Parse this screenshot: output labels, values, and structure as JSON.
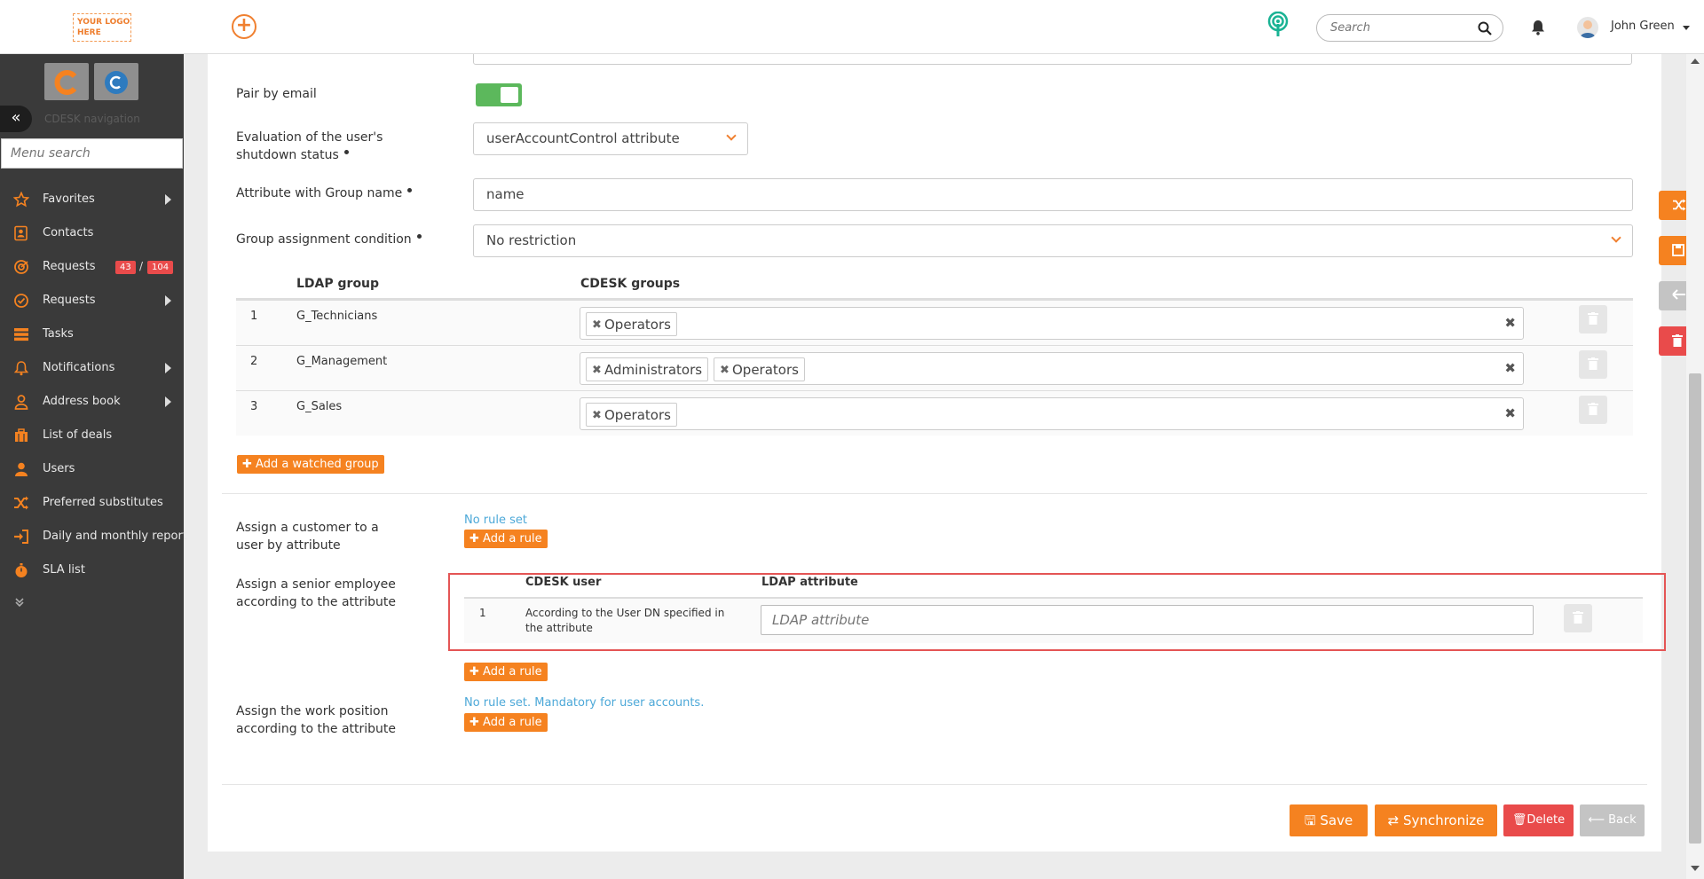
{
  "header": {
    "logo_line1": "YOUR LOGO",
    "logo_line2": "HERE",
    "search_placeholder": "Search",
    "user_name": "John Green"
  },
  "sidebar": {
    "nav_title": "CDESK navigation",
    "menu_search_placeholder": "Menu search",
    "items": [
      {
        "label": "Favorites",
        "icon": "star-icon",
        "submenu": true
      },
      {
        "label": "Contacts",
        "icon": "contact-card-icon",
        "submenu": false
      },
      {
        "label": "Requests",
        "icon": "requests-icon",
        "submenu": false,
        "badge1": "43",
        "badge_sep": "/",
        "badge2": "104"
      },
      {
        "label": "Requests",
        "icon": "check-circle-icon",
        "submenu": true
      },
      {
        "label": "Tasks",
        "icon": "tasks-icon",
        "submenu": false
      },
      {
        "label": "Notifications",
        "icon": "bell-icon",
        "submenu": true
      },
      {
        "label": "Address book",
        "icon": "person-outline-icon",
        "submenu": true
      },
      {
        "label": "List of deals",
        "icon": "deals-icon",
        "submenu": false
      },
      {
        "label": "Users",
        "icon": "user-icon",
        "submenu": false
      },
      {
        "label": "Preferred substitutes",
        "icon": "shuffle-icon",
        "submenu": false
      },
      {
        "label": "Daily and monthly report",
        "icon": "sign-in-icon",
        "submenu": false
      },
      {
        "label": "SLA list",
        "icon": "stopwatch-icon",
        "submenu": false
      }
    ],
    "more_icon": "double-chevron-down-icon"
  },
  "form": {
    "pair_by_email_label": "Pair by email",
    "pair_by_email_on": true,
    "shutdown_label": "Evaluation of the user's shutdown status",
    "shutdown_value": "userAccountControl attribute",
    "group_name_attr_label": "Attribute with Group name",
    "group_name_attr_value": "name",
    "group_condition_label": "Group assignment condition",
    "group_condition_value": "No restriction",
    "groups_table": {
      "headers": [
        "LDAP group",
        "CDESK groups"
      ],
      "rows": [
        {
          "num": "1",
          "ldap_group": "G_Technicians",
          "cdesk_groups": [
            "Operators"
          ]
        },
        {
          "num": "2",
          "ldap_group": "G_Management",
          "cdesk_groups": [
            "Administrators",
            "Operators"
          ]
        },
        {
          "num": "3",
          "ldap_group": "G_Sales",
          "cdesk_groups": [
            "Operators"
          ]
        }
      ]
    },
    "add_watched_group": "Add a watched group",
    "customer_label": "Assign a customer to a user by attribute",
    "customer_status": "No rule set",
    "add_rule": "Add a rule",
    "senior_label": "Assign a senior employee according to the attribute",
    "senior_table": {
      "headers": [
        "CDESK user",
        "LDAP attribute"
      ],
      "row": {
        "num": "1",
        "cdesk_user": "According to the User DN specified in the attribute",
        "ldap_placeholder": "LDAP attribute"
      }
    },
    "work_position_label": "Assign the work position according to the attribute",
    "work_position_status": "No rule set. Mandatory for user accounts."
  },
  "footer": {
    "save": "Save",
    "synchronize": "Synchronize",
    "delete": "Delete",
    "back": "Back"
  },
  "colors": {
    "accent": "#f58220",
    "danger": "#e94b4b",
    "toggle_on": "#5cb85c",
    "link": "#4ca8d8",
    "sidebar_bg": "#3a3a3a"
  }
}
